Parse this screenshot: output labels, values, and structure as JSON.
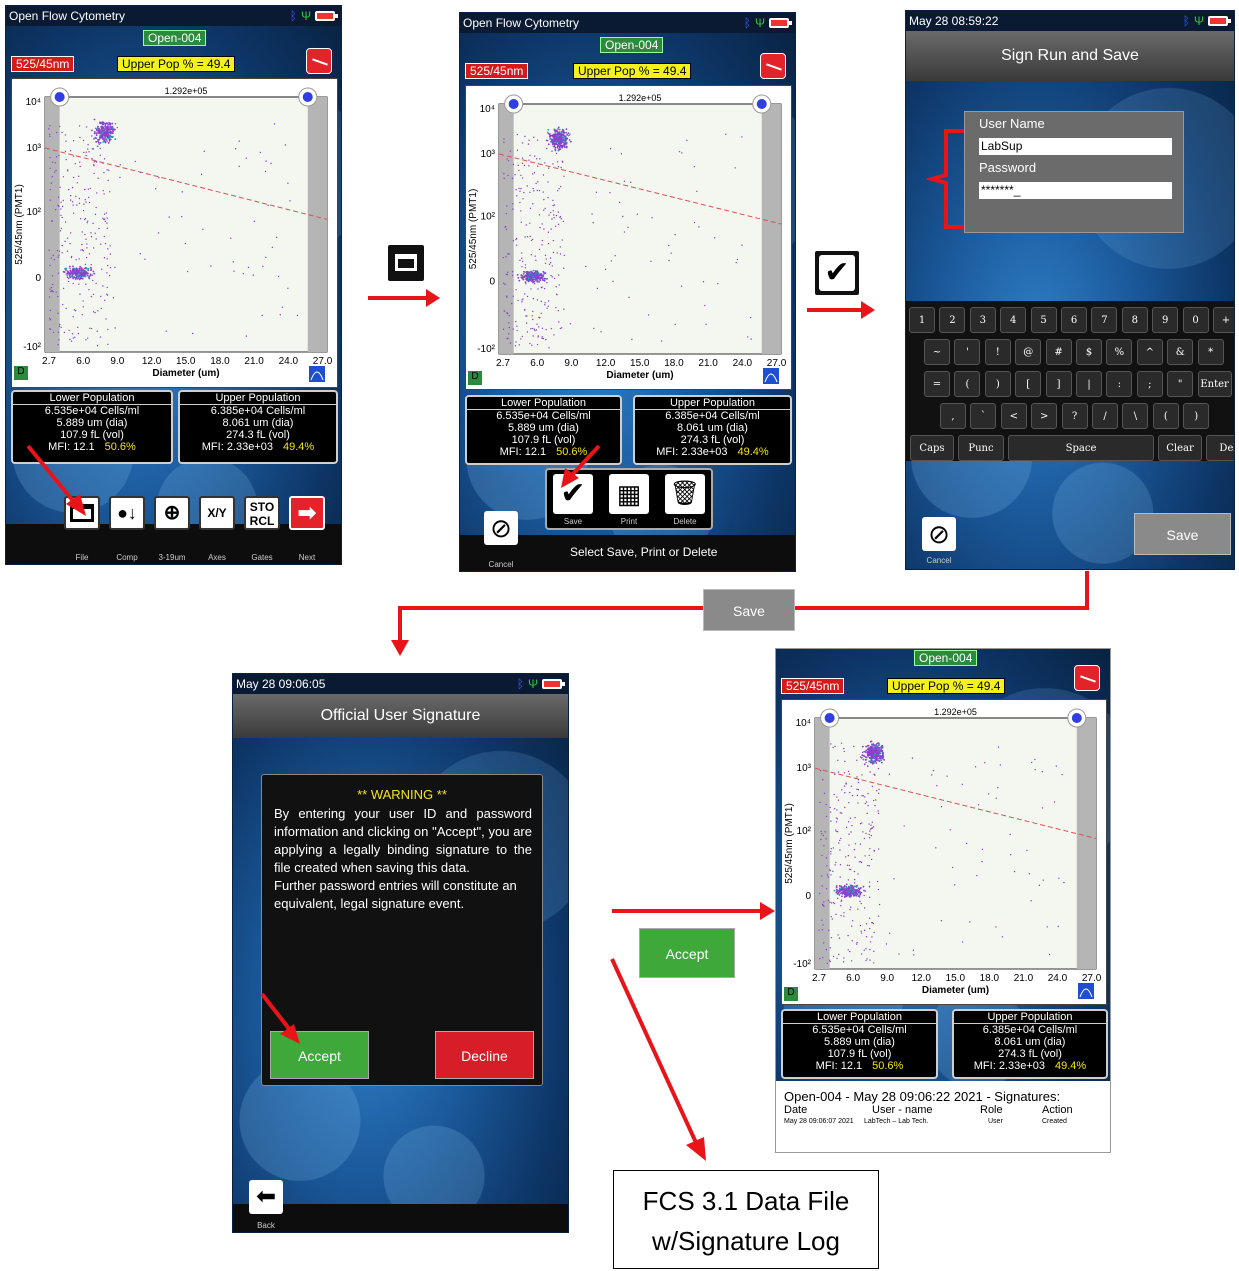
{
  "screen1": {
    "app_title": "Open Flow Cytometry",
    "sample_tag": "Open-004",
    "channel_tag": "525/45nm",
    "upper_pop": "Upper Pop % = 49.4",
    "d_badge": "D",
    "toolbar": [
      {
        "label": "File"
      },
      {
        "label": "Comp"
      },
      {
        "label": "3-19um"
      },
      {
        "label": "Axes",
        "glyph": "X/Y"
      },
      {
        "label": "Gates",
        "glyph": "STO RCL"
      },
      {
        "label": "Next"
      }
    ]
  },
  "plot": {
    "gate_value": "1.292e+05",
    "y_label": "525/45nm (PMT1)",
    "x_label": "Diameter (um)",
    "y_ticks": [
      "10⁴",
      "10³",
      "10²",
      "0",
      "-10²"
    ],
    "x_ticks": [
      "2.7",
      "6.0",
      "9.0",
      "12.0",
      "15.0",
      "18.0",
      "21.0",
      "24.0",
      "27.0"
    ]
  },
  "populations": {
    "lower": {
      "title": "Lower Population",
      "cells": "6.535e+04 Cells/ml",
      "dia": "5.889 um (dia)",
      "vol": "107.9 fL (vol)",
      "mfi": "MFI:  12.1",
      "pct": "50.6%"
    },
    "upper": {
      "title": "Upper Population",
      "cells": "6.385e+04 Cells/ml",
      "dia": "8.061 um (dia)",
      "vol": "274.3 fL (vol)",
      "mfi": "MFI: 2.33e+03",
      "pct": "49.4%"
    }
  },
  "screen2": {
    "app_title": "Open Flow Cytometry",
    "actions": [
      {
        "label": "Save"
      },
      {
        "label": "Print"
      },
      {
        "label": "Delete"
      }
    ],
    "cancel": "Cancel",
    "hint": "Select Save, Print or Delete"
  },
  "screen3": {
    "time": "May 28 08:59:22",
    "title": "Sign Run and Save",
    "user_label": "User Name",
    "user_value": "LabSup",
    "pass_label": "Password",
    "pass_value": "*******_",
    "keyboard_rows": [
      [
        "1",
        "2",
        "3",
        "4",
        "5",
        "6",
        "7",
        "8",
        "9",
        "0",
        "+"
      ],
      [
        "~",
        "'",
        "!",
        "@",
        "#",
        "$",
        "%",
        "^",
        "&",
        "*"
      ],
      [
        "=",
        "(",
        ")",
        "[",
        "]",
        "|",
        ":",
        ";",
        "\"",
        "Enter"
      ],
      [
        ",",
        "`",
        "<",
        ">",
        "?",
        "/",
        "\\",
        "(",
        ")"
      ],
      [
        "Caps",
        "Punc",
        "Space",
        "Clear",
        "Del"
      ]
    ],
    "cancel": "Cancel",
    "save": "Save"
  },
  "flow_save_button": "Save",
  "screen4": {
    "time": "May 28 09:06:05",
    "title": "Official User Signature",
    "warning_title": "** WARNING **",
    "warning_text": "By entering your user ID and password information and clicking on \"Accept\", you are applying a legally binding signature to the file created when saving this data.",
    "warning_text2": "Further password entries will constitute an equivalent, legal signature event.",
    "accept": "Accept",
    "decline": "Decline",
    "back": "Back"
  },
  "flow_accept_button": "Accept",
  "screen5": {
    "log_title": "Open-004 - May 28 09:06:22 2021 - Signatures:",
    "headers": [
      "Date",
      "User - name",
      "Role",
      "Action"
    ],
    "row": [
      "May 28 09:06:07 2021",
      "LabTech – Lab Tech.",
      "User",
      "Created"
    ]
  },
  "fcs_box": {
    "line1": "FCS 3.1 Data File",
    "line2": "w/Signature Log"
  },
  "colors": {
    "accent_red": "#e8141a",
    "tag_green": "#2c8a3c",
    "tag_yellow": "#f4f21a",
    "scatter": "#8a3fd1"
  }
}
